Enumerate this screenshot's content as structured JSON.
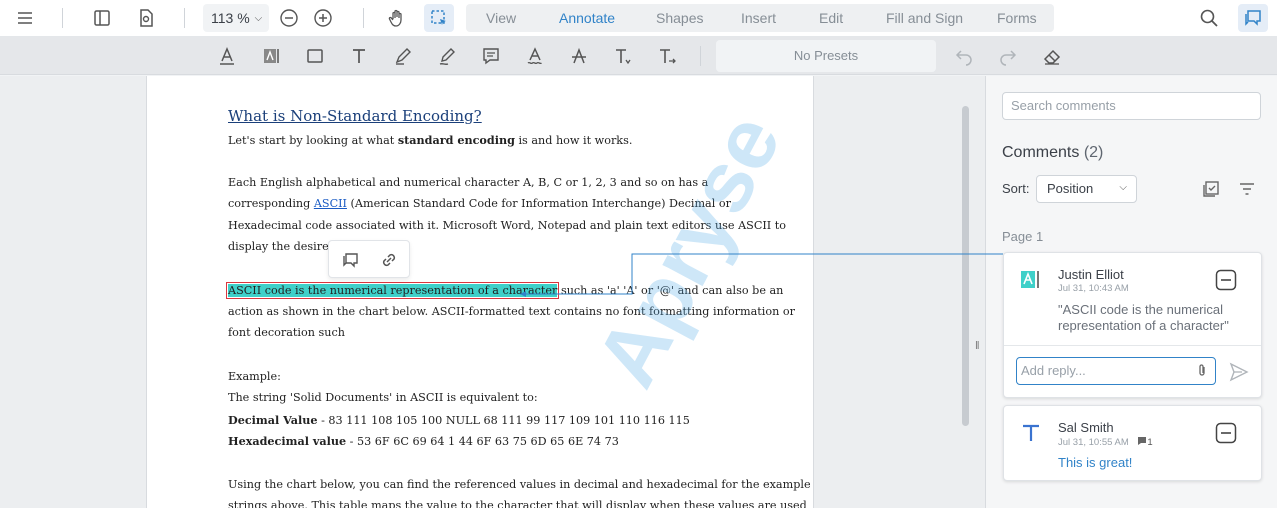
{
  "toolbar": {
    "zoom_value": "113 %",
    "tabs": [
      "View",
      "Annotate",
      "Shapes",
      "Insert",
      "Edit",
      "Fill and Sign",
      "Forms"
    ],
    "active_tab": "Annotate"
  },
  "subtoolbar": {
    "presets_label": "No Presets"
  },
  "document": {
    "heading": "What is Non-Standard Encoding?",
    "line1_pre": "Let's start by looking at what ",
    "line1_bold": "standard encoding",
    "line1_post": " is and how it works.",
    "p2_l1": "Each English alphabetical and numerical character A, B, C or 1, 2, 3 and so on has a",
    "p2_l2_pre": "corresponding ",
    "p2_l2_link": "ASCII",
    "p2_l2_post": " (American Standard Code for Information Interchange) Decimal or",
    "p2_l3": "Hexadecimal code associated with it. Microsoft Word, Notepad and plain text editors use ASCII to",
    "p2_l4": "display the desired characters.",
    "p3_highlight": "ASCII code is the numerical representation of a character",
    "p3_l1_post": " such as 'a' 'A' or '@' and can also be an",
    "p3_l2": "action as shown in the chart below. ASCII-formatted text contains no font formatting information or",
    "p3_l3": "font decoration such",
    "example": "Example:",
    "example_desc": "The string 'Solid Documents' in ASCII is equivalent to:",
    "decimal_label": "Decimal Value",
    "decimal_value": " - 83 111 108 105 100 NULL 68 111 99 117 109 101 110 116 115",
    "hex_label": "Hexadecimal value",
    "hex_value": " - 53 6F 6C 69 64 1 44 6F 63 75 6D 65 6E 74 73",
    "p5_l1": "Using the chart below, you can find the referenced values in decimal and hexadecimal for the example",
    "p5_l2": "strings above. This table maps the value to the character that will display when these values are used",
    "watermark": "Apryse"
  },
  "comments_panel": {
    "search_placeholder": "Search comments",
    "title": "Comments",
    "count": "(2)",
    "sort_label": "Sort:",
    "sort_value": "Position",
    "page_label": "Page 1",
    "comments": [
      {
        "author": "Justin Elliot",
        "date": "Jul 31, 10:43 AM",
        "quote": "\"ASCII code is the numerical representation of a character\"",
        "reply_placeholder": "Add reply...",
        "icon": "highlight-icon"
      },
      {
        "author": "Sal Smith",
        "date": "Jul 31, 10:55 AM",
        "reply_count": "1",
        "message": "This is great!",
        "icon": "text-icon"
      }
    ]
  },
  "colors": {
    "accent": "#3183c8",
    "highlight": "#3fd0c9",
    "highlight_border": "#d9363e"
  }
}
